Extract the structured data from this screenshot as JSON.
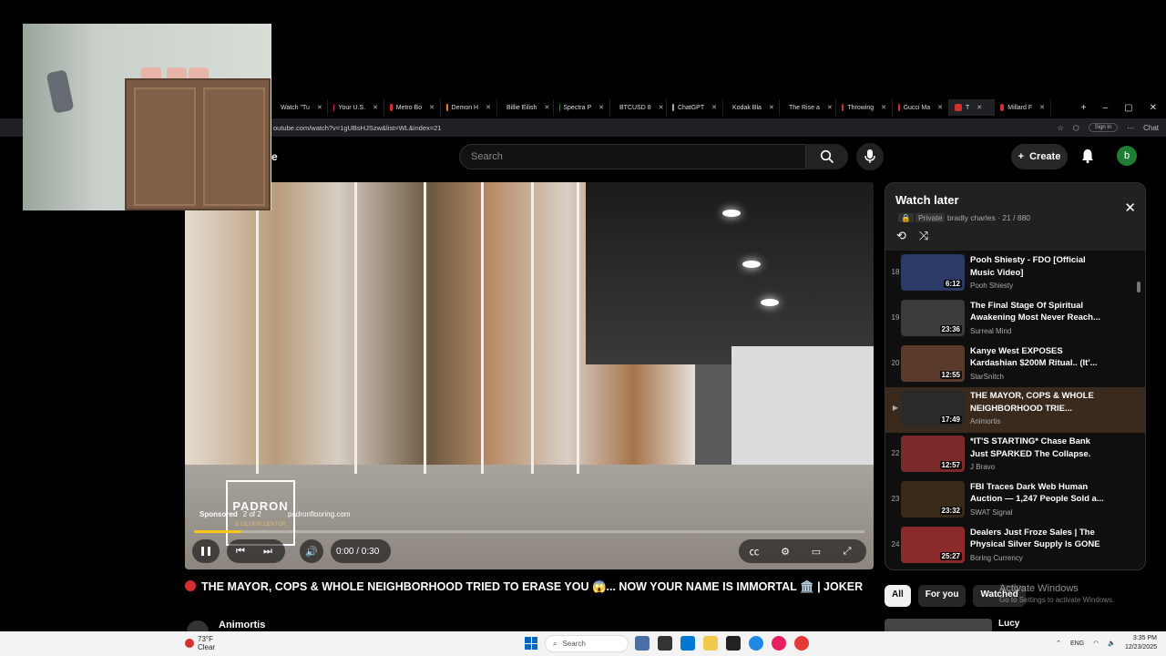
{
  "browser": {
    "tabs": [
      {
        "label": "Watch \"Tu",
        "color": "#d32f2f"
      },
      {
        "label": "Your U.S.",
        "color": "#c2185b"
      },
      {
        "label": "Metro Bo",
        "color": "#d32f2f"
      },
      {
        "label": "Demon H",
        "color": "#e67e22"
      },
      {
        "label": "Billie Eilish",
        "color": "#888888"
      },
      {
        "label": "Spectra P",
        "color": "#2e7d32"
      },
      {
        "label": "BTCUSD 8",
        "color": "#ffffff"
      },
      {
        "label": "ChatGPT",
        "color": "#aaaaaa"
      },
      {
        "label": "Kodak Bla",
        "color": "#d32f2f"
      },
      {
        "label": "The Rise a",
        "color": "#d32f2f"
      },
      {
        "label": "Throwing",
        "color": "#d32f2f"
      },
      {
        "label": "Gucci Ma",
        "color": "#d32f2f"
      },
      {
        "label": "T",
        "color": "#d32f2f"
      },
      {
        "label": "Millard F",
        "color": "#d32f2f"
      }
    ],
    "url": "outube.com/watch?v=1gUBsHJSzw&list=WL&index=21",
    "signin": "Sign in",
    "chat": "Chat"
  },
  "header": {
    "logo_fragment": "e",
    "search_placeholder": "Search",
    "create_label": "Create",
    "avatar_letter": "b"
  },
  "player": {
    "ad_brand": "PADRON",
    "ad_sub": "& DESIGN CENTER",
    "sponsored_label": "Sponsored",
    "sponsored_count": "2 of 2",
    "ad_url": "padronflooring.com",
    "time": "0:00 / 0:30",
    "progress_fraction": 0.07
  },
  "video_title": "THE MAYOR, COPS & WHOLE NEIGHBORHOOD TRIED TO ERASE YOU 😱... NOW YOUR NAME IS IMMORTAL 🏛️ | JOKER",
  "channel_name": "Animortis",
  "playlist": {
    "title": "Watch later",
    "privacy": "Private",
    "owner": "bradly charles",
    "position": "21 / 880",
    "items": [
      {
        "index": "18",
        "title": "Pooh Shiesty - FDO [Official Music Video]",
        "channel": "Pooh Shiesty",
        "duration": "6:12",
        "thumb_color": "#2b3a66"
      },
      {
        "index": "19",
        "title": "The Final Stage Of Spiritual Awakening Most Never Reach...",
        "channel": "Surreal Mind",
        "duration": "23:36",
        "thumb_color": "#3b3b3b"
      },
      {
        "index": "20",
        "title": "Kanye West EXPOSES Kardashian $200M Ritual.. (It'...",
        "channel": "StarSnitch",
        "duration": "12:55",
        "thumb_color": "#5a3a2a"
      },
      {
        "index": "▶",
        "title": "THE MAYOR, COPS & WHOLE NEIGHBORHOOD TRIE...",
        "channel": "Animortis",
        "duration": "17:49",
        "thumb_color": "#2a2a2a",
        "current": true
      },
      {
        "index": "22",
        "title": "*IT'S STARTING* Chase Bank Just SPARKED The Collapse.",
        "channel": "J Bravo",
        "duration": "12:57",
        "thumb_color": "#7a2a2a"
      },
      {
        "index": "23",
        "title": "FBI Traces Dark Web Human Auction — 1,247 People Sold a...",
        "channel": "SWAT Signal",
        "duration": "23:32",
        "thumb_color": "#3a2a1a"
      },
      {
        "index": "24",
        "title": "Dealers Just Froze Sales | The Physical Silver Supply Is GONE",
        "channel": "Boring Currency",
        "duration": "25:27",
        "thumb_color": "#8a2a2a"
      }
    ]
  },
  "filter_chips": [
    "All",
    "For you",
    "Watched"
  ],
  "watermark": {
    "title": "Activate Windows",
    "sub": "Go to Settings to activate Windows."
  },
  "next_item_title": "Lucy",
  "taskbar": {
    "temp": "73°F",
    "condition": "Clear",
    "search_label": "Search",
    "lang": "ENG",
    "time": "3:35 PM",
    "date": "12/23/2025"
  }
}
